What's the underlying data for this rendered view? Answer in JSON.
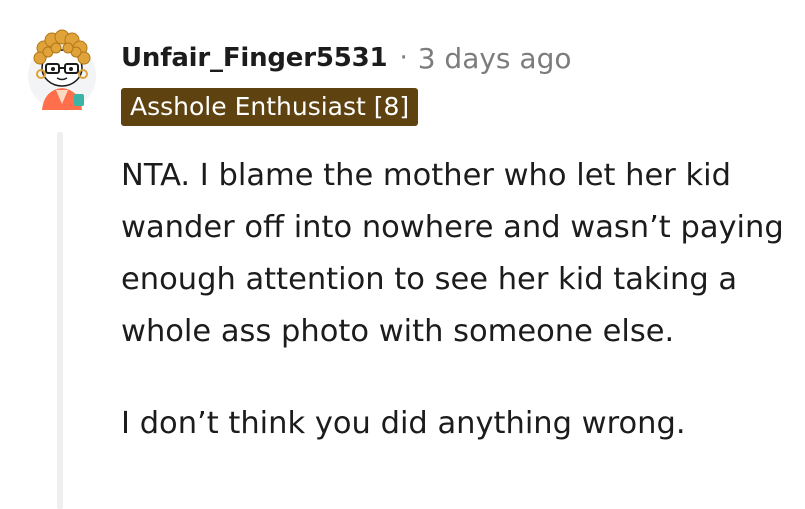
{
  "comment": {
    "username": "Unfair_Finger5531",
    "separator": "·",
    "timestamp": "3 days ago",
    "flair": "Asshole Enthusiast [8]",
    "paragraphs": [
      "NTA. I blame the mother who let her kid wander off into nowhere and wasn’t paying enough attention to see her kid taking a whole ass photo with someone else.",
      "I don’t think you did anything wrong."
    ],
    "avatar_icon": "snoo-avatar-icon"
  },
  "colors": {
    "flair_bg": "#5e4210",
    "flair_text": "#ffffff",
    "meta_text": "#7c7c7c",
    "body_text": "#1c1c1c",
    "thread_line": "#edeff1"
  }
}
